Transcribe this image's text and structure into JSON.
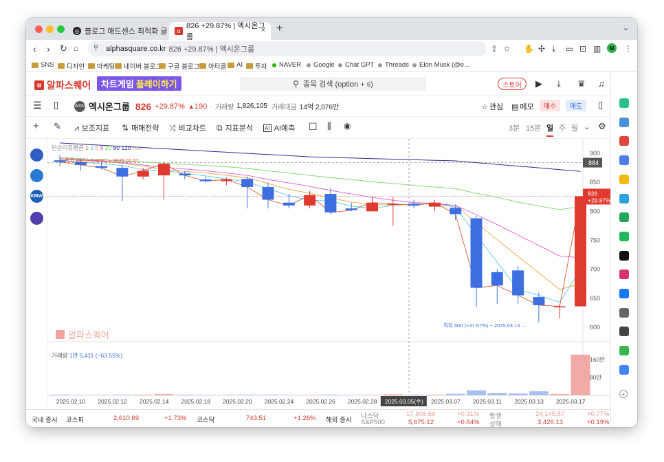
{
  "browser": {
    "tabs": [
      {
        "title": "블로그 애드센스 최적화 글쓰기"
      },
      {
        "title": "826 +29.87% | 엑시온그룹",
        "close": "×"
      }
    ],
    "new_tab": "+",
    "address": {
      "domain": "alphasquare.co.kr",
      "title": "826 +29.87% | 엑시온그룹"
    },
    "bookmarks": [
      {
        "label": "SNS"
      },
      {
        "label": "디자인"
      },
      {
        "label": "마케팅"
      },
      {
        "label": "네이버 블로그"
      },
      {
        "label": "구글 블로그"
      },
      {
        "label": "아티클"
      },
      {
        "label": "AI"
      },
      {
        "label": "투자"
      },
      {
        "label": "NAVER"
      },
      {
        "label": "Google"
      },
      {
        "label": "Chat GPT"
      },
      {
        "label": "Threads"
      },
      {
        "label": "Elon Musk (@e..."
      }
    ]
  },
  "site": {
    "logo": "알파스퀘어",
    "promo": {
      "part1": "차트게임",
      "part2": "플레이하기"
    },
    "search_placeholder": "종목 검색 (option + s)",
    "store_label": "스토어"
  },
  "stock": {
    "name": "엑시온그룹",
    "logo_text": "AXN",
    "price": "826",
    "change_pct": "+29.87%",
    "change_abs": "190",
    "volume_label": "거래량",
    "volume": "1,826,105",
    "amount_label": "거래대금",
    "amount": "14억 2,076만",
    "watch_label": "관심",
    "memo_label": "메모",
    "buy_label": "매수",
    "sell_label": "매도"
  },
  "toolbar": {
    "items": [
      "보조지표",
      "매매전략",
      "비교차트",
      "지표분석",
      "AI예측"
    ],
    "periods": [
      "3분",
      "15분",
      "일",
      "주",
      "월"
    ],
    "selected_period": "일"
  },
  "left_icons": [
    {
      "text": "",
      "color": "#2f5fc4"
    },
    {
      "text": "",
      "color": "#2a7ad4"
    },
    {
      "text": "KMW",
      "color": "#1f5fb8"
    },
    {
      "text": "",
      "color": "#4f3fae"
    }
  ],
  "chart_data": {
    "type": "candlestick",
    "ma_legend": {
      "label": "단순이동평균",
      "periods": [
        "1",
        "3",
        "5",
        "8",
        "20",
        "60",
        "120",
        "360"
      ]
    },
    "high_annotation": "← 최고 897 (−7.92%) − 2025.02.07",
    "low_annotation": "최저 600 (+37.67%) − 2025.03.13 →",
    "watermark": "알파스퀘어",
    "y_ticks": [
      900,
      850,
      800,
      750,
      700,
      650,
      600
    ],
    "ylim": [
      575,
      925
    ],
    "price_tag": {
      "value": "884"
    },
    "last_tag": {
      "price": "826",
      "change": "+29.87%"
    },
    "candles": [
      {
        "o": 888,
        "h": 897,
        "l": 878,
        "c": 885
      },
      {
        "o": 885,
        "h": 890,
        "l": 870,
        "c": 880
      },
      {
        "o": 878,
        "h": 885,
        "l": 872,
        "c": 875
      },
      {
        "o": 875,
        "h": 880,
        "l": 818,
        "c": 860
      },
      {
        "o": 860,
        "h": 875,
        "l": 855,
        "c": 870
      },
      {
        "o": 862,
        "h": 885,
        "l": 820,
        "c": 882
      },
      {
        "o": 865,
        "h": 870,
        "l": 855,
        "c": 862
      },
      {
        "o": 855,
        "h": 860,
        "l": 850,
        "c": 852
      },
      {
        "o": 852,
        "h": 858,
        "l": 845,
        "c": 855
      },
      {
        "o": 856,
        "h": 860,
        "l": 805,
        "c": 842
      },
      {
        "o": 842,
        "h": 850,
        "l": 805,
        "c": 820
      },
      {
        "o": 815,
        "h": 830,
        "l": 805,
        "c": 810
      },
      {
        "o": 810,
        "h": 835,
        "l": 805,
        "c": 828
      },
      {
        "o": 830,
        "h": 840,
        "l": 795,
        "c": 798
      },
      {
        "o": 805,
        "h": 815,
        "l": 800,
        "c": 802
      },
      {
        "o": 800,
        "h": 825,
        "l": 800,
        "c": 815
      },
      {
        "o": 812,
        "h": 825,
        "l": 775,
        "c": 813
      },
      {
        "o": 813,
        "h": 820,
        "l": 805,
        "c": 810
      },
      {
        "o": 808,
        "h": 820,
        "l": 800,
        "c": 815
      },
      {
        "o": 806,
        "h": 812,
        "l": 785,
        "c": 795
      },
      {
        "o": 788,
        "h": 792,
        "l": 635,
        "c": 668
      },
      {
        "o": 695,
        "h": 700,
        "l": 640,
        "c": 672
      },
      {
        "o": 698,
        "h": 705,
        "l": 640,
        "c": 655
      },
      {
        "o": 652,
        "h": 660,
        "l": 608,
        "c": 638
      },
      {
        "o": 635,
        "h": 640,
        "l": 615,
        "c": 636
      },
      {
        "o": 636,
        "h": 826,
        "l": 636,
        "c": 826
      }
    ],
    "ma_lines": [
      {
        "period": "3",
        "color": "#55c8e8",
        "values": [
          888,
          885,
          882,
          879,
          872,
          870,
          866,
          861,
          856,
          851,
          839,
          827,
          819,
          818,
          809,
          805,
          810,
          813,
          813,
          807,
          759,
          712,
          665,
          655,
          643,
          700
        ]
      },
      {
        "period": "5",
        "color": "#e7a23c",
        "values": [
          890,
          888,
          886,
          883,
          878,
          872,
          869,
          866,
          862,
          858,
          848,
          838,
          831,
          823,
          816,
          811,
          811,
          813,
          812,
          810,
          780,
          751,
          722,
          694,
          665,
          675
        ]
      },
      {
        "period": "20",
        "color": "#7ad66a",
        "values": [
          893,
          891,
          889,
          887,
          885,
          883,
          881,
          879,
          877,
          874,
          870,
          866,
          862,
          858,
          855,
          851,
          848,
          845,
          842,
          839,
          831,
          824,
          816,
          809,
          803,
          808
        ]
      },
      {
        "period": "8",
        "color": "#d858d6",
        "values": [
          891,
          889,
          887,
          884,
          880,
          876,
          873,
          870,
          866,
          862,
          855,
          849,
          843,
          836,
          830,
          824,
          819,
          815,
          814,
          810,
          794,
          777,
          759,
          741,
          723,
          720
        ]
      },
      {
        "period": "1",
        "color": "#d65b35",
        "values": [
          885,
          880,
          875,
          860,
          870,
          882,
          862,
          852,
          855,
          842,
          820,
          810,
          828,
          798,
          802,
          815,
          813,
          810,
          815,
          795,
          668,
          672,
          655,
          638,
          636,
          826
        ]
      },
      {
        "period": "60",
        "color": "#2c2c8c",
        "values": [
          918,
          916,
          914,
          912,
          910,
          908,
          906,
          904,
          902,
          900,
          898,
          896,
          894,
          893,
          892,
          891,
          890,
          889,
          888,
          887,
          884,
          881,
          878,
          875,
          872,
          869
        ]
      }
    ],
    "volume": {
      "label": "거래량",
      "value_text": "1만 5,411 (−63.55%)",
      "y_ticks": [
        "160만",
        "80만"
      ],
      "values": [
        3,
        2,
        2,
        3,
        3,
        6,
        3,
        2,
        2,
        3,
        3,
        2,
        2,
        3,
        2,
        2,
        5,
        3,
        3,
        7,
        22,
        10,
        8,
        18,
        6,
        182
      ]
    },
    "x_labels": [
      "2025.02.10",
      "2025.02.12",
      "2025.02.14",
      "2025.02.18",
      "2025.02.20",
      "2025.02.24",
      "2025.02.26",
      "2025.02.28",
      "2025.03.05(수)",
      "2025.03.07",
      "2025.03.11",
      "2025.03.13",
      "2025.03.17"
    ]
  },
  "status": {
    "domestic_label": "국내 증시",
    "kospi_label": "코스피",
    "kospi_value": "2,610.69",
    "kospi_change": "+1.73%",
    "kosdaq_label": "코스닥",
    "kosdaq_value": "743.51",
    "kosdaq_change": "+1.26%",
    "overseas_label": "해외 증시",
    "nasdaq_label": "나스닥",
    "nasdaq_value": "17,808.66",
    "nasdaq_change": "+0.31%",
    "sp_label": "S&P500",
    "sp_value": "5,675.12",
    "sp_change": "+0.64%",
    "hangseng_label": "항셍",
    "hangseng_value": "24,145.57",
    "hangseng_change": "+0.77%",
    "shanghai_label": "상해",
    "shanghai_value": "3,426.13",
    "shanghai_change": "+0.19%"
  },
  "right_sidebar": [
    {
      "color": "#2ac08a"
    },
    {
      "color": "#4a90d9"
    },
    {
      "color": "#e0453b"
    },
    {
      "color": "#4f7be8"
    },
    {
      "color": "#f2b90f"
    },
    {
      "color": "#2da0e0"
    },
    {
      "color": "#26a65b"
    },
    {
      "color": "#1fb85c"
    },
    {
      "color": "#111111"
    },
    {
      "color": "#d6336c"
    },
    {
      "color": "#1877f2"
    },
    {
      "color": "#666666"
    },
    {
      "color": "#444444"
    },
    {
      "color": "#3ab54a"
    },
    {
      "color": "#4285f4"
    }
  ]
}
